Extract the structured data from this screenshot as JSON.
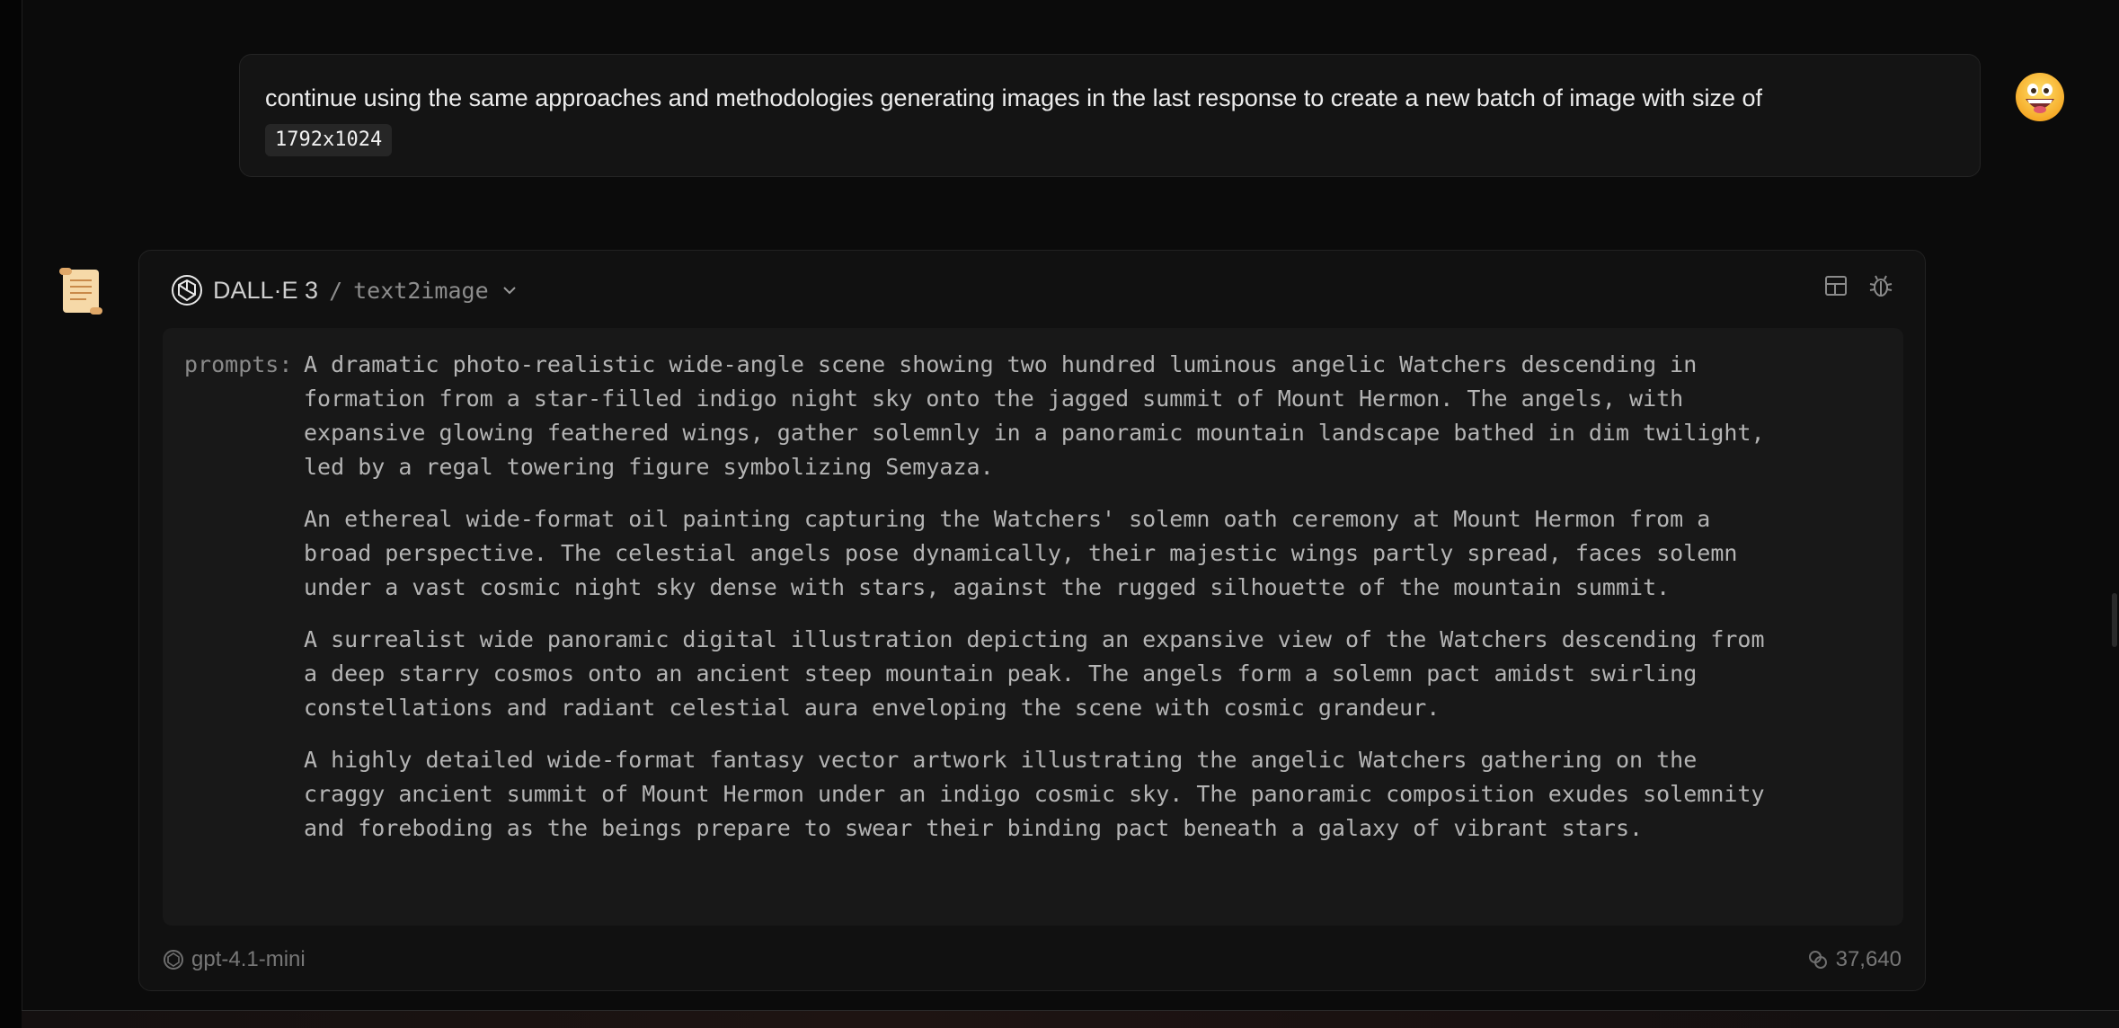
{
  "user_message": {
    "text": "continue using the same approaches and methodologies generating images in the last response to create a new batch of image with size of",
    "code": "1792x1024",
    "avatar_icon": "grinning-face-emoji"
  },
  "assistant": {
    "avatar_icon": "scroll-emoji",
    "tool": {
      "model_name": "DALL·E 3",
      "separator": "/",
      "function_name": "text2image",
      "icon": "openai-logo-icon",
      "dropdown_icon": "chevron-down-icon",
      "tools": [
        "layout-icon",
        "bug-icon"
      ]
    },
    "prompts_key": "prompts:",
    "prompts": [
      "A dramatic photo-realistic wide-angle scene showing two hundred luminous angelic Watchers descending in formation from a star-filled indigo night sky onto the jagged summit of Mount Hermon. The angels, with expansive glowing feathered wings, gather solemnly in a panoramic mountain landscape bathed in dim twilight, led by a regal towering figure symbolizing Semyaza.",
      "An ethereal wide-format oil painting capturing the Watchers' solemn oath ceremony at Mount Hermon from a broad perspective. The celestial angels pose dynamically, their majestic wings partly spread, faces solemn under a vast cosmic night sky dense with stars, against the rugged silhouette of the mountain summit.",
      "A surrealist wide panoramic digital illustration depicting an expansive view of the Watchers descending from a deep starry cosmos onto an ancient steep mountain peak. The angels form a solemn pact amidst swirling constellations and radiant celestial aura enveloping the scene with cosmic grandeur.",
      "A highly detailed wide-format fantasy vector artwork illustrating the angelic Watchers gathering on the craggy ancient summit of Mount Hermon under an indigo cosmic sky. The panoramic composition exudes solemnity and foreboding as the beings prepare to swear their binding pact beneath a galaxy of vibrant stars."
    ],
    "footer": {
      "model": "gpt-4.1-mini",
      "tokens": "37,640"
    }
  },
  "colors": {
    "background": "#0b0b0b",
    "card": "#111111",
    "prompt_box": "#181818",
    "text": "#e6e6e6",
    "muted": "#777777"
  }
}
